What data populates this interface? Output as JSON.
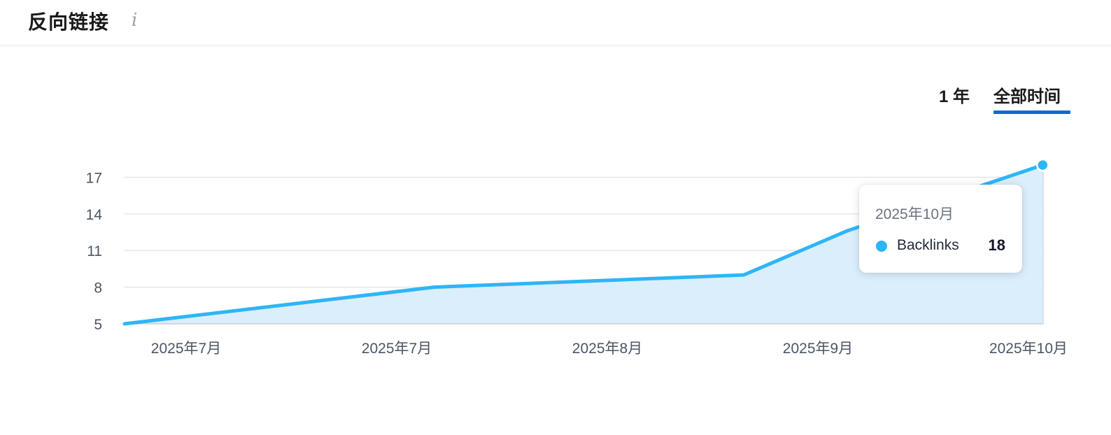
{
  "header": {
    "title": "反向链接",
    "info_icon": "info-icon"
  },
  "tabs": [
    {
      "label": "1 年",
      "active": false
    },
    {
      "label": "全部时间",
      "active": true
    }
  ],
  "colors": {
    "line": "#2eb5f7",
    "area": "#dbeefc",
    "grid": "#e3e6ea",
    "tab_underline": "#0a6ad6"
  },
  "chart_data": {
    "type": "area",
    "x": [
      "2025年7月",
      "2025年7月",
      "2025年8月",
      "2025年9月",
      "2025年10月"
    ],
    "x_ticks": [
      0,
      1,
      2,
      3,
      4
    ],
    "points": [
      {
        "x": 0,
        "y": 5
      },
      {
        "x": 1.47,
        "y": 8
      },
      {
        "x": 2.94,
        "y": 9
      },
      {
        "x": 3.43,
        "y": 12.6
      },
      {
        "x": 4.36,
        "y": 18
      }
    ],
    "series": [
      {
        "name": "Backlinks",
        "color": "#2eb5f7"
      }
    ],
    "y_ticks": [
      5,
      8,
      11,
      14,
      17
    ],
    "ylim": [
      5,
      18
    ],
    "grid": true,
    "tooltip": {
      "date": "2025年10月",
      "series": "Backlinks",
      "value": "18"
    }
  }
}
